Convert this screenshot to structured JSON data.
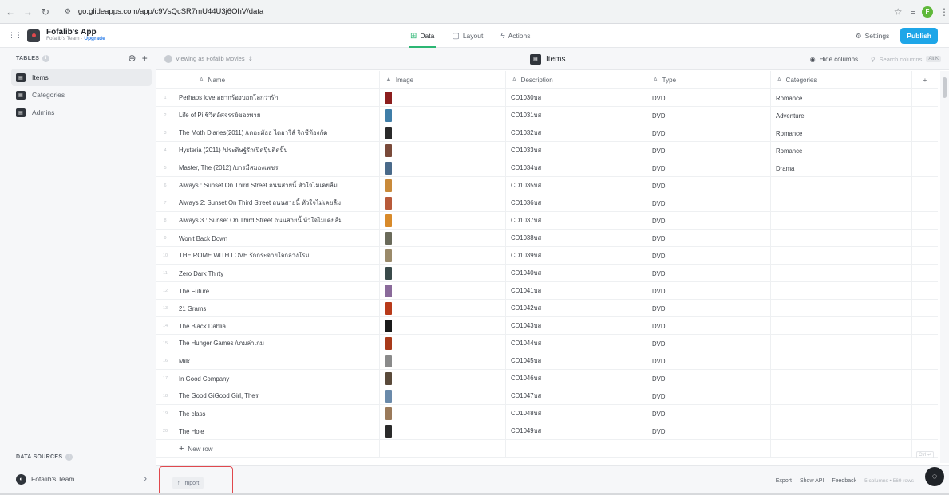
{
  "browser": {
    "url": "go.glideapps.com/app/c9VsQcSR7mU44U3j6OhV/data",
    "profile_initial": "F"
  },
  "header": {
    "app_name": "Fofalib's App",
    "team": "Fofalib's Team",
    "upgrade": "Upgrade",
    "tabs": [
      {
        "label": "Data",
        "active": true
      },
      {
        "label": "Layout",
        "active": false
      },
      {
        "label": "Actions",
        "active": false
      }
    ],
    "settings_label": "Settings",
    "publish_label": "Publish",
    "colors": {
      "publish": "#1ea6e8",
      "active_tab": "#2bb673"
    }
  },
  "sidebar": {
    "tables_heading": "TABLES",
    "tables": [
      {
        "label": "Items",
        "active": true
      },
      {
        "label": "Categories",
        "active": false
      },
      {
        "label": "Admins",
        "active": false
      }
    ],
    "data_sources_heading": "DATA SOURCES",
    "data_source": "Fofalib's Team"
  },
  "toolbar": {
    "viewing_as": "Viewing as Fofalib Movies",
    "table_title": "Items",
    "hide_columns": "Hide columns",
    "search_placeholder": "Search columns",
    "search_kbd": "Alt K"
  },
  "grid": {
    "columns": [
      {
        "type": "A",
        "label": "Name"
      },
      {
        "type": "img",
        "label": "Image"
      },
      {
        "type": "A",
        "label": "Description"
      },
      {
        "type": "A",
        "label": "Type"
      },
      {
        "type": "A",
        "label": "Categories"
      }
    ],
    "rows": [
      {
        "n": "1",
        "name": "Perhaps love อยากร้องบอกโลกว่ารัก",
        "desc": "CD1030บส",
        "type": "DVD",
        "cat": "Romance",
        "thumb": "#8c1d1d"
      },
      {
        "n": "2",
        "name": "Life of Pi ชีวิตอัศจรรย์ของพาย",
        "desc": "CD1031บส",
        "type": "DVD",
        "cat": "Adventure",
        "thumb": "#3f7ea8"
      },
      {
        "n": "3",
        "name": "The Moth Diaries(2011) /เดอะมัธธ ไดอารี่ส์ จิกชีท้องกัด",
        "desc": "CD1032บส",
        "type": "DVD",
        "cat": "Romance",
        "thumb": "#2a2a2a"
      },
      {
        "n": "4",
        "name": "Hysteria (2011) /ประดิษฐ์รักเปิดปุ๊ปติดปั๊ป",
        "desc": "CD1033บส",
        "type": "DVD",
        "cat": "Romance",
        "thumb": "#7a4a3a"
      },
      {
        "n": "5",
        "name": "Master, The (2012) /บารมีสมองเพชร",
        "desc": "CD1034บส",
        "type": "DVD",
        "cat": "Drama",
        "thumb": "#4a6a8a"
      },
      {
        "n": "6",
        "name": "Always : Sunset On Third Street ถนนสายนี้ หัวใจไม่เคยลืม",
        "desc": "CD1035บส",
        "type": "DVD",
        "cat": "",
        "thumb": "#c98a3a"
      },
      {
        "n": "7",
        "name": "Always 2: Sunset On Third Street ถนนสายนี้ หัวใจไม่เคยลืม",
        "desc": "CD1036บส",
        "type": "DVD",
        "cat": "",
        "thumb": "#b85a3a"
      },
      {
        "n": "8",
        "name": "Always 3 : Sunset On Third Street ถนนสายนี้ หัวใจไม่เคยลืม",
        "desc": "CD1037บส",
        "type": "DVD",
        "cat": "",
        "thumb": "#d88a2a"
      },
      {
        "n": "9",
        "name": "Won't Back Down",
        "desc": "CD1038บส",
        "type": "DVD",
        "cat": "",
        "thumb": "#6a6a5a"
      },
      {
        "n": "10",
        "name": "THE ROME WITH LOVE รักกระจายใจกลางโรม",
        "desc": "CD1039บส",
        "type": "DVD",
        "cat": "",
        "thumb": "#9a8a6a"
      },
      {
        "n": "11",
        "name": "Zero Dark Thirty",
        "desc": "CD1040บส",
        "type": "DVD",
        "cat": "",
        "thumb": "#3a4a4a"
      },
      {
        "n": "12",
        "name": "The Future",
        "desc": "CD1041บส",
        "type": "DVD",
        "cat": "",
        "thumb": "#8a6a9a"
      },
      {
        "n": "13",
        "name": "21 Grams",
        "desc": "CD1042บส",
        "type": "DVD",
        "cat": "",
        "thumb": "#b83a1a"
      },
      {
        "n": "14",
        "name": "The Black Dahlia",
        "desc": "CD1043บส",
        "type": "DVD",
        "cat": "",
        "thumb": "#1a1a1a"
      },
      {
        "n": "15",
        "name": "The Hunger Games /เกมล่าเกม",
        "desc": "CD1044บส",
        "type": "DVD",
        "cat": "",
        "thumb": "#a83a1a"
      },
      {
        "n": "16",
        "name": "Milk",
        "desc": "CD1045บส",
        "type": "DVD",
        "cat": "",
        "thumb": "#8a8a8a"
      },
      {
        "n": "17",
        "name": "In Good Company",
        "desc": "CD1046บส",
        "type": "DVD",
        "cat": "",
        "thumb": "#5a4a3a"
      },
      {
        "n": "18",
        "name": "The Good GiGood Girl, Theร",
        "desc": "CD1047บส",
        "type": "DVD",
        "cat": "",
        "thumb": "#6a8aaa"
      },
      {
        "n": "19",
        "name": "The class",
        "desc": "CD1048บส",
        "type": "DVD",
        "cat": "",
        "thumb": "#9a7a5a"
      },
      {
        "n": "20",
        "name": "The Hole",
        "desc": "CD1049บส",
        "type": "DVD",
        "cat": "",
        "thumb": "#2a2a2a"
      }
    ],
    "new_row_label": "New row",
    "ctrl_hint": "Ctrl ↵"
  },
  "footer": {
    "import_label": "Import",
    "export_label": "Export",
    "show_api_label": "Show API",
    "feedback_label": "Feedback",
    "count_label": "5 columns • 569 rows"
  }
}
